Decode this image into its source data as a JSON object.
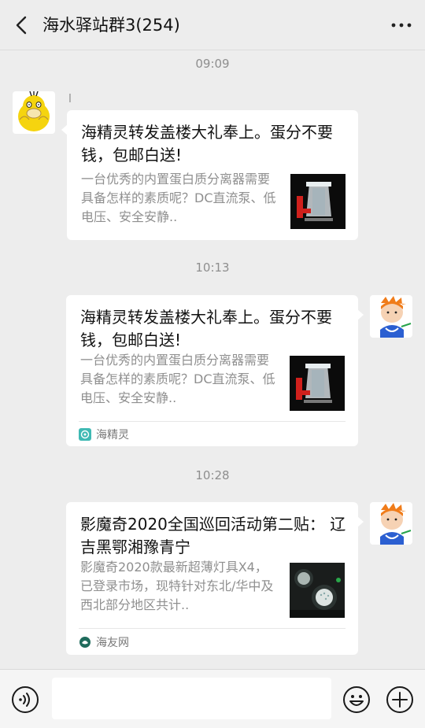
{
  "header": {
    "title": "海水驿站群3(254)"
  },
  "messages": [
    {
      "time": "09:09",
      "sender": "l",
      "title": "海精灵转发盖楼大礼奉上。蛋分不要钱，包邮白送!",
      "desc": "一台优秀的内置蛋白质分离器需要具备怎样的素质呢？DC直流泵、低电压、安全安静.."
    },
    {
      "time": "10:13",
      "title": "海精灵转发盖楼大礼奉上。蛋分不要钱，包邮白送!",
      "desc": "一台优秀的内置蛋白质分离器需要具备怎样的素质呢？DC直流泵、低电压、安全安静..",
      "source": "海精灵"
    },
    {
      "time": "10:28",
      "title": "影魔奇2020全国巡回活动第二贴： 辽吉黑鄂湘豫青宁",
      "desc": "影魔奇2020款最新超薄灯具X4，已登录市场，现特针对东北/华中及西北部分地区共计..",
      "source": "海友网"
    }
  ],
  "icons": {
    "back": "chevron-left-icon",
    "more": "more-dots-icon",
    "voice": "voice-icon",
    "emoji": "emoji-icon",
    "add": "plus-circle-icon"
  }
}
